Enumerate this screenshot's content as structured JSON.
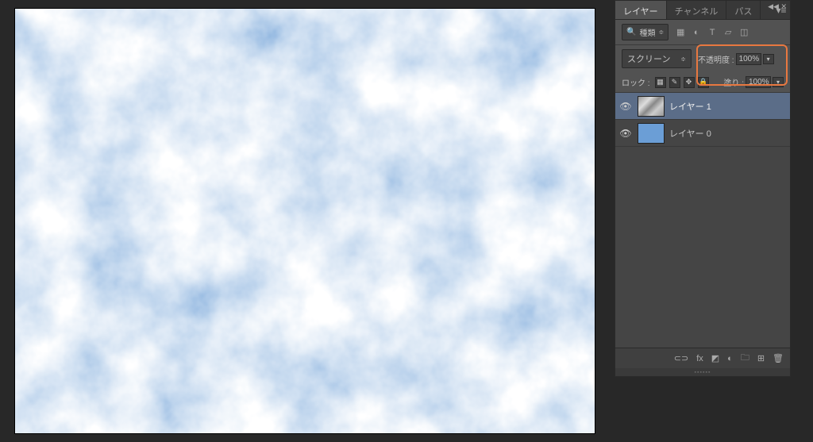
{
  "tabs": {
    "layers": "レイヤー",
    "channels": "チャンネル",
    "paths": "パス"
  },
  "filter": {
    "kind_label": "種類"
  },
  "blend": {
    "mode": "スクリーン",
    "opacity_label": "不透明度 :",
    "opacity_value": "100%",
    "lock_label": "ロック :",
    "fill_label": "塗り :",
    "fill_value": "100%"
  },
  "layers": [
    {
      "name": "レイヤー 1",
      "selected": true,
      "thumb": "cloud"
    },
    {
      "name": "レイヤー 0",
      "selected": false,
      "thumb": "solid"
    }
  ],
  "footer_fx": "fx"
}
